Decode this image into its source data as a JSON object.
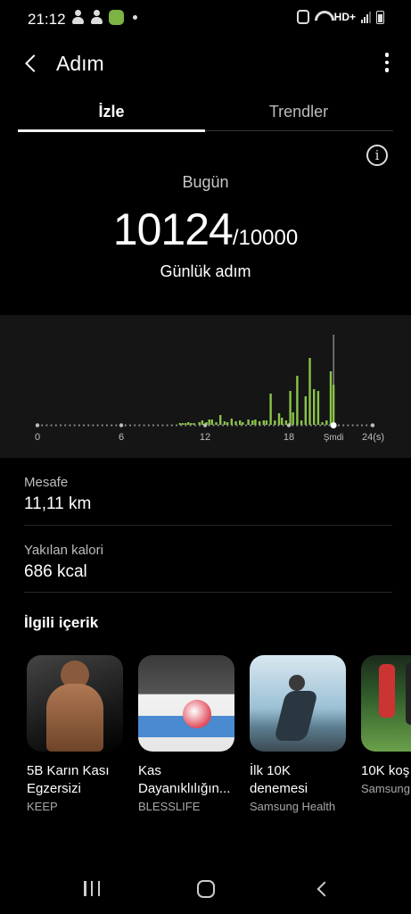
{
  "status_bar": {
    "time": "21:12",
    "network": "HD+",
    "left_icons": [
      "person-icon",
      "person-icon",
      "app-icon",
      "dot-icon"
    ],
    "right_icons": [
      "alarm-icon",
      "wifi-icon",
      "signal-icon",
      "battery-icon"
    ]
  },
  "header": {
    "title": "Adım",
    "back_icon": "back-arrow-icon",
    "more_icon": "more-vertical-icon"
  },
  "tabs": [
    {
      "label": "İzle",
      "active": true
    },
    {
      "label": "Trendler",
      "active": false
    }
  ],
  "summary": {
    "day_label": "Bugün",
    "steps": "10124",
    "goal": "/10000",
    "caption": "Günlük adım",
    "info_icon": "info-icon"
  },
  "chart_data": {
    "type": "bar",
    "xlabel": "",
    "ylabel": "",
    "x_tick_labels": [
      "0",
      "6",
      "12",
      "18",
      "Şmdi",
      "24(s)"
    ],
    "x_range": [
      0,
      24
    ],
    "y_range": [
      0,
      1
    ],
    "bar_color": "#8bc34a",
    "now_marker_hour": 21.2,
    "series": [
      {
        "x": [
          10.2,
          10.4,
          10.6,
          10.8,
          11.0,
          11.2,
          11.6,
          11.8,
          12.1,
          12.3,
          12.5,
          12.8,
          13.1,
          13.4,
          13.6,
          13.9,
          14.2,
          14.5,
          14.7,
          15.1,
          15.4,
          15.6,
          15.9,
          16.2,
          16.4,
          16.7,
          17.0,
          17.3,
          17.5,
          17.8,
          18.1,
          18.3,
          18.6,
          18.9,
          19.2,
          19.5,
          19.8,
          20.1,
          20.4,
          20.7,
          21.0,
          21.2
        ],
        "values": [
          0.02,
          0.02,
          0.02,
          0.03,
          0.02,
          0.02,
          0.03,
          0.05,
          0.03,
          0.06,
          0.06,
          0.03,
          0.11,
          0.04,
          0.03,
          0.07,
          0.04,
          0.05,
          0.03,
          0.06,
          0.05,
          0.06,
          0.04,
          0.05,
          0.05,
          0.35,
          0.05,
          0.13,
          0.08,
          0.05,
          0.38,
          0.14,
          0.55,
          0.05,
          0.32,
          0.75,
          0.4,
          0.38,
          0.03,
          0.05,
          0.6,
          0.45
        ]
      }
    ]
  },
  "stats": {
    "distance": {
      "label": "Mesafe",
      "value": "11,11 km"
    },
    "calories": {
      "label": "Yakılan kalori",
      "value": "686 kcal"
    }
  },
  "related": {
    "title": "İlgili içerik",
    "cards": [
      {
        "title_line1": "5B Karın Kası",
        "title_line2": "Egzersizi",
        "source": "KEEP"
      },
      {
        "title_line1": "Kas",
        "title_line2": "Dayanıklılığın...",
        "source": "BLESSLIFE"
      },
      {
        "title_line1": "İlk 10K",
        "title_line2": "denemesi",
        "source": "Samsung Health"
      },
      {
        "title_line1": "10K koş",
        "title_line2": "",
        "source": "Samsung"
      }
    ]
  },
  "nav_bar": {
    "icons": [
      "recents-icon",
      "home-icon",
      "back-icon"
    ]
  }
}
